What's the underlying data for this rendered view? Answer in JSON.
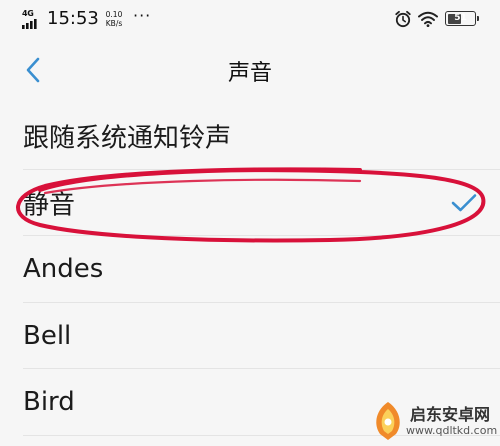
{
  "status_bar": {
    "network": "4G",
    "time": "15:53",
    "speed_value": "0.10",
    "speed_unit": "KB/s",
    "more": "···",
    "battery_level": "51",
    "battery_fraction": 0.51,
    "icons": [
      "signal-icon",
      "alarm-icon",
      "wifi-icon",
      "battery-icon"
    ]
  },
  "header": {
    "back_icon": "chevron-left-icon",
    "title": "声音"
  },
  "ringtones": {
    "items": [
      {
        "label": "跟随系统通知铃声",
        "selected": false
      },
      {
        "label": "静音",
        "selected": true
      },
      {
        "label": "Andes",
        "selected": false
      },
      {
        "label": "Bell",
        "selected": false
      },
      {
        "label": "Bird",
        "selected": false
      }
    ]
  },
  "watermark": {
    "title": "启东安卓网",
    "url": "www.qdltkd.com"
  },
  "colors": {
    "accent": "#3a8fd0",
    "annotation": "#d8113a",
    "background": "#f6f6f6"
  }
}
